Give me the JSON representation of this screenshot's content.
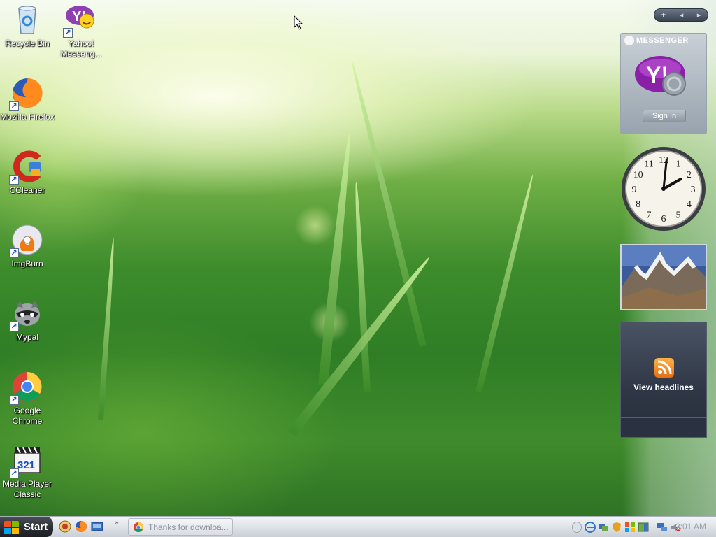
{
  "desktop": {
    "icons": [
      {
        "label": "Recycle Bin",
        "icon": "recycle-bin-icon",
        "shortcut": false
      },
      {
        "label": "Yahoo! Messeng...",
        "icon": "yahoo-messenger-icon",
        "shortcut": true
      },
      {
        "label": "Mozilla Firefox",
        "icon": "firefox-icon",
        "shortcut": true
      },
      {
        "label": "CCleaner",
        "icon": "ccleaner-icon",
        "shortcut": true
      },
      {
        "label": "ImgBurn",
        "icon": "imgburn-icon",
        "shortcut": true
      },
      {
        "label": "Mypal",
        "icon": "mypal-icon",
        "shortcut": true
      },
      {
        "label": "Google Chrome",
        "icon": "chrome-icon",
        "shortcut": true
      },
      {
        "label": "Media Player Classic",
        "icon": "media-player-classic-icon",
        "shortcut": true
      }
    ],
    "shortcut_glyph": "↗"
  },
  "sidebar": {
    "controls": {
      "add": "+",
      "prev": "◂",
      "next": "▸"
    },
    "yahoo_gadget": {
      "header": "MESSENGER",
      "logo_text": "Y!",
      "sign_in": "Sign In"
    },
    "clock": {
      "numbers": [
        "12",
        "1",
        "2",
        "3",
        "4",
        "5",
        "6",
        "7",
        "8",
        "9",
        "10",
        "11"
      ],
      "hour": 2,
      "minute": 1
    },
    "feed": {
      "label": "View headlines"
    }
  },
  "taskbar": {
    "start_label": "Start",
    "task_button": {
      "label": "Thanks for downloa...",
      "icon": "chrome-icon"
    },
    "clock_time": "2:01 AM"
  },
  "colors": {
    "accent": "#3d8c2c",
    "yahoo_purple": "#7b1fa2",
    "rss_orange": "#e96e10"
  }
}
